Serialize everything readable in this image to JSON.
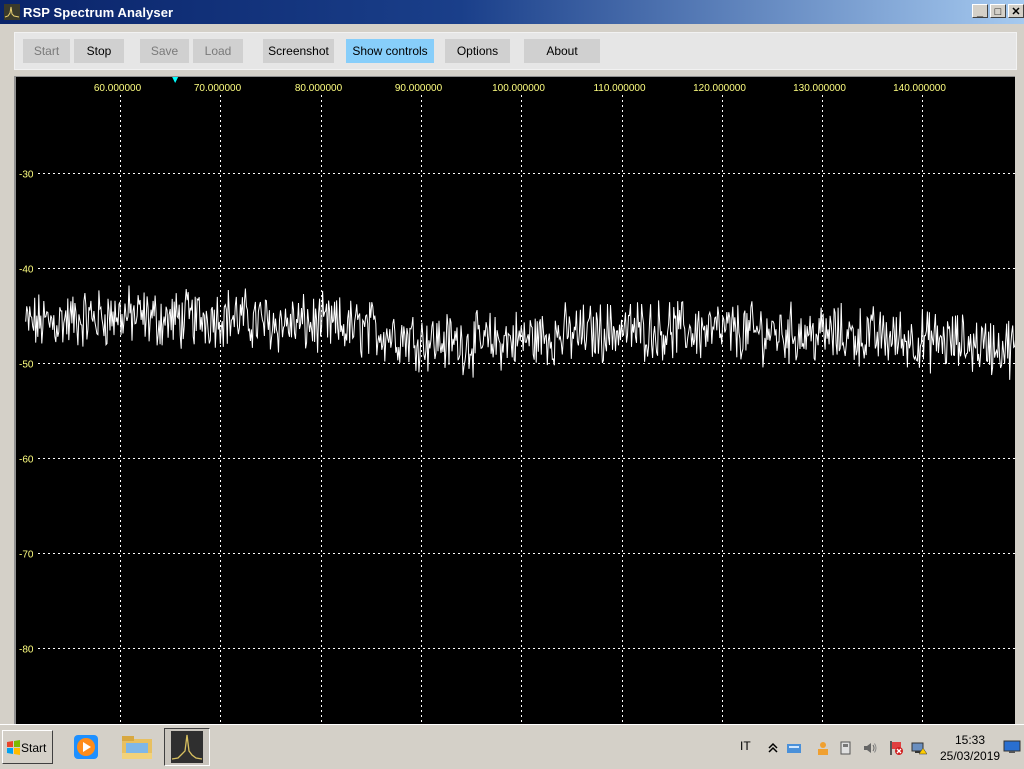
{
  "window": {
    "title": "RSP Spectrum Analyser",
    "controls": {
      "minimize": "_",
      "maximize": "□",
      "close": "✕"
    }
  },
  "toolbar": {
    "buttons": [
      {
        "label": "Start",
        "state": "disabled"
      },
      {
        "label": "Stop",
        "state": "normal"
      },
      {
        "label": "Save",
        "state": "disabled"
      },
      {
        "label": "Load",
        "state": "disabled"
      },
      {
        "label": "Screenshot",
        "state": "normal"
      },
      {
        "label": "Show controls",
        "state": "active"
      },
      {
        "label": "Options",
        "state": "normal"
      },
      {
        "label": "About",
        "state": "normal"
      }
    ]
  },
  "chart_data": {
    "type": "line",
    "title": "",
    "xlabel": "",
    "ylabel": "",
    "x_tick_labels": [
      "60.000000",
      "70.000000",
      "80.000000",
      "90.000000",
      "100.000000",
      "110.000000",
      "120.000000",
      "130.000000",
      "140.000000"
    ],
    "x_ticks": [
      60,
      70,
      80,
      90,
      100,
      110,
      120,
      130,
      140
    ],
    "y_tick_labels": [
      "-30",
      "-40",
      "-50",
      "-60",
      "-70",
      "-80"
    ],
    "y_ticks": [
      -30,
      -40,
      -50,
      -60,
      -70,
      -80
    ],
    "xlim": [
      50,
      150
    ],
    "ylim": [
      -88,
      -20
    ],
    "grid": true,
    "marker_x": 65.5,
    "colors": {
      "background": "#000000",
      "trace": "#ffffff",
      "grid": "#ffffff",
      "tick_labels": "#ffff80",
      "marker": "#00ffff"
    },
    "series": [
      {
        "x": [
          50,
          55,
          60,
          65,
          70,
          75,
          80,
          85,
          90,
          95,
          100,
          105,
          110,
          115,
          120,
          125,
          130,
          135,
          140,
          145,
          150
        ],
        "y": [
          -46,
          -45.5,
          -45,
          -45.5,
          -45,
          -45.8,
          -46,
          -46.5,
          -47.5,
          -48,
          -47.5,
          -47,
          -46.5,
          -46.5,
          -46.7,
          -46.8,
          -47,
          -47.2,
          -47.6,
          -48,
          -48.5
        ],
        "noise_db": 2.5
      }
    ]
  },
  "taskbar": {
    "start_label": "Start",
    "icons": [
      "media-player-icon",
      "file-explorer-icon",
      "spectrum-analyser-icon"
    ],
    "language": "IT",
    "clock_time": "15:33",
    "clock_date": "25/03/2019"
  }
}
